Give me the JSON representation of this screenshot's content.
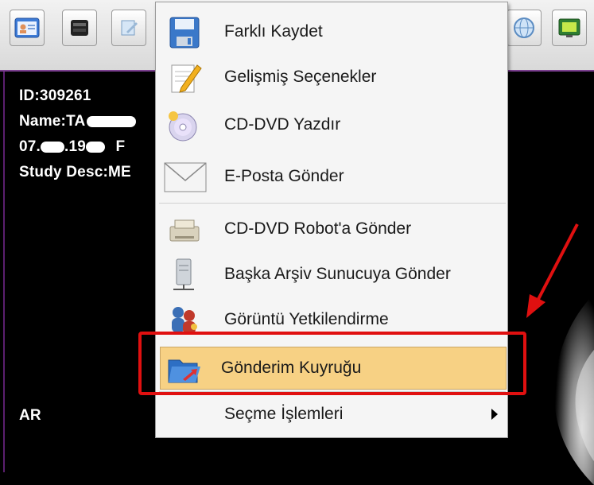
{
  "toolbar": {
    "buttons": [
      {
        "icon": "patient-card-icon"
      },
      {
        "icon": "hdd-icon"
      },
      {
        "icon": "edit-note-icon"
      },
      {
        "icon": "globe-icon"
      },
      {
        "icon": "monitor-icon"
      }
    ]
  },
  "overlay": {
    "id": "ID:309261",
    "name": "Name:TA",
    "dob_prefix": "07.",
    "dob_mid": ".19",
    "sex": "F",
    "study": "Study Desc:ME",
    "orientation": "AR"
  },
  "menu": {
    "items": [
      {
        "label": "Farklı Kaydet",
        "icon": "floppy-disk-icon"
      },
      {
        "label": "Gelişmiş Seçenekler",
        "icon": "pencil-notepad-icon"
      },
      {
        "label": "CD-DVD Yazdır",
        "icon": "cd-dvd-icon"
      },
      {
        "label": "E-Posta Gönder",
        "icon": "envelope-icon"
      },
      {
        "label": "CD-DVD Robot'a Gönder",
        "icon": "printer-robot-icon"
      },
      {
        "label": "Başka Arşiv Sunucuya Gönder",
        "icon": "server-icon"
      },
      {
        "label": "Görüntü Yetkilendirme",
        "icon": "users-keys-icon"
      },
      {
        "label": "Gönderim Kuyruğu",
        "icon": "send-queue-folder-icon",
        "highlighted": true
      },
      {
        "label": "Seçme İşlemleri",
        "icon": "",
        "has_submenu": true
      }
    ]
  },
  "colors": {
    "highlight": "#f7d184",
    "annotation": "#e01010"
  }
}
